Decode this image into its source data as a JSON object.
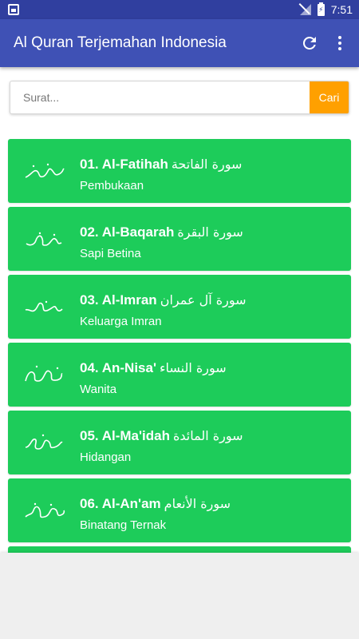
{
  "status_bar": {
    "time": "7:51",
    "battery_glyph": "⚡"
  },
  "app_bar": {
    "title": "Al Quran Terjemahan Indonesia",
    "icons": [
      "refresh-icon",
      "more-vert-icon"
    ]
  },
  "search": {
    "placeholder": "Surat...",
    "button_label": "Cari"
  },
  "colors": {
    "app_bar": "#3F51B5",
    "status_bar": "#303F9F",
    "card": "#1DCC5A",
    "search_button": "#FFA000"
  },
  "surahs": [
    {
      "title": "01. Al-Fatihah",
      "arabic": "سورة الفاتحة",
      "meaning": "Pembukaan"
    },
    {
      "title": "02. Al-Baqarah",
      "arabic": "سورة البقرة",
      "meaning": "Sapi Betina"
    },
    {
      "title": "03. Al-Imran",
      "arabic": "سورة آل عمران",
      "meaning": "Keluarga Imran"
    },
    {
      "title": "04. An-Nisa'",
      "arabic": "سورة النساء",
      "meaning": "Wanita"
    },
    {
      "title": "05. Al-Ma'idah",
      "arabic": "سورة المائدة",
      "meaning": "Hidangan"
    },
    {
      "title": "06. Al-An'am",
      "arabic": "سورة الأنعام",
      "meaning": "Binatang Ternak"
    }
  ]
}
